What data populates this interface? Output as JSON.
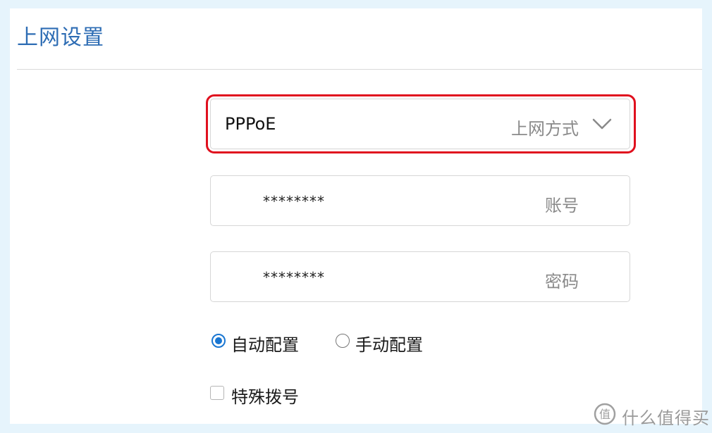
{
  "page": {
    "title": "上网设置"
  },
  "connection": {
    "value": "PPPoE",
    "label": "上网方式"
  },
  "account": {
    "value": "********",
    "label": "账号"
  },
  "password": {
    "value": "********",
    "label": "密码"
  },
  "config_mode": {
    "options": [
      {
        "label": "自动配置",
        "checked": true
      },
      {
        "label": "手动配置",
        "checked": false
      }
    ]
  },
  "special_dial": {
    "label": "特殊拨号",
    "checked": false
  },
  "watermark": {
    "text": "什么值得买",
    "logo": "smzdm-logo-icon"
  },
  "colors": {
    "title": "#2e6db4",
    "highlight": "#e0101e",
    "radio": "#1976d2",
    "background": "#e6f4fc"
  }
}
